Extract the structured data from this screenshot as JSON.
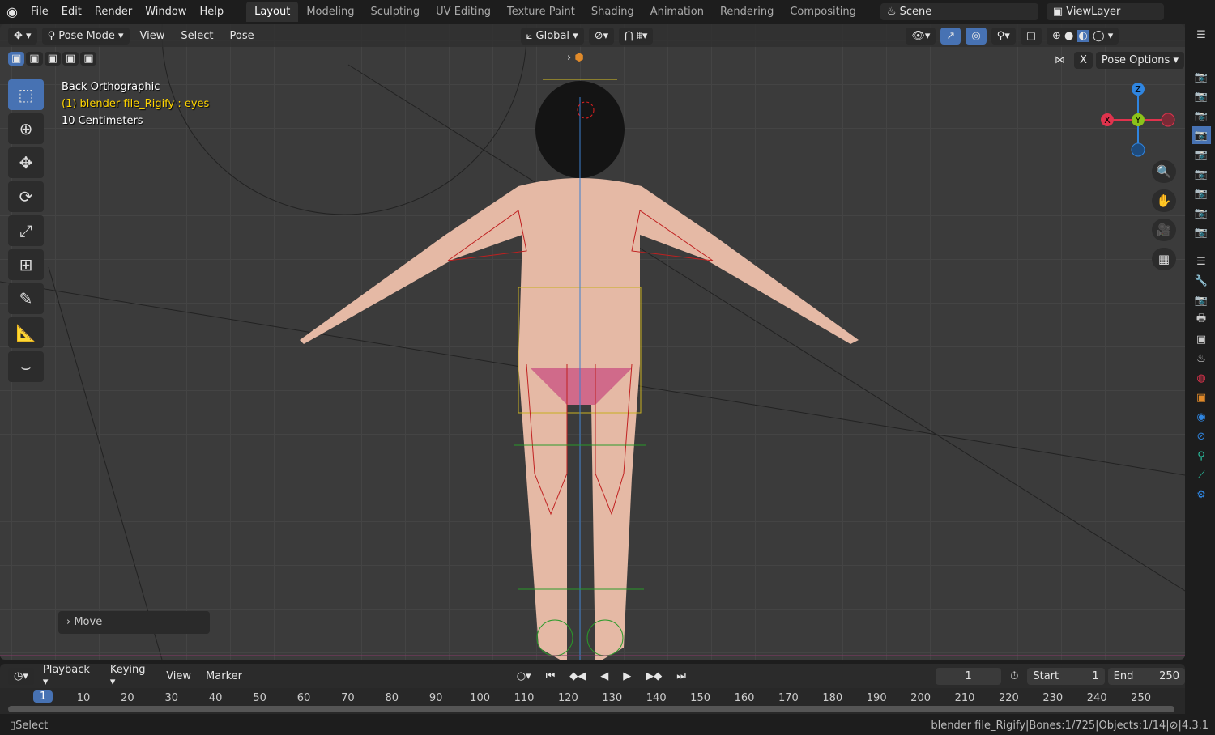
{
  "topbar": {
    "menus": [
      "File",
      "Edit",
      "Render",
      "Window",
      "Help"
    ],
    "workspaces": [
      "Layout",
      "Modeling",
      "Sculpting",
      "UV Editing",
      "Texture Paint",
      "Shading",
      "Animation",
      "Rendering",
      "Compositing"
    ],
    "active_workspace": "Layout",
    "scene": "Scene",
    "view_layer": "ViewLayer"
  },
  "viewport_header": {
    "mode": "Pose Mode",
    "menus": [
      "View",
      "Select",
      "Pose"
    ],
    "orientation": "Global",
    "pose_options": "Pose Options",
    "x_mirror": "X"
  },
  "overlay_info": {
    "view": "Back Orthographic",
    "object": "(1) blender file_Rigify : eyes",
    "scale": "10 Centimeters"
  },
  "gizmo": {
    "x": "X",
    "y": "Y",
    "z": "Z"
  },
  "operator_panel": {
    "label": "Move"
  },
  "timeline": {
    "menus": [
      "Playback",
      "Keying",
      "View",
      "Marker"
    ],
    "current_frame": "1",
    "start_label": "Start",
    "start": "1",
    "end_label": "End",
    "end": "250",
    "ticks": [
      "10",
      "20",
      "30",
      "40",
      "50",
      "60",
      "70",
      "80",
      "90",
      "100",
      "110",
      "120",
      "130",
      "140",
      "150",
      "160",
      "170",
      "180",
      "190",
      "200",
      "210",
      "220",
      "230",
      "240",
      "250"
    ],
    "playhead": "1"
  },
  "status": {
    "left": "Select",
    "file": "blender file_Rigify",
    "bones": "Bones:1/725",
    "objects": "Objects:1/14",
    "version": "4.3.1"
  },
  "colors": {
    "accent": "#4772b3",
    "active_object_text": "#ffd500",
    "x_axis": "#e0334d",
    "y_axis": "#8cc21a",
    "z_axis": "#2f85e0"
  }
}
